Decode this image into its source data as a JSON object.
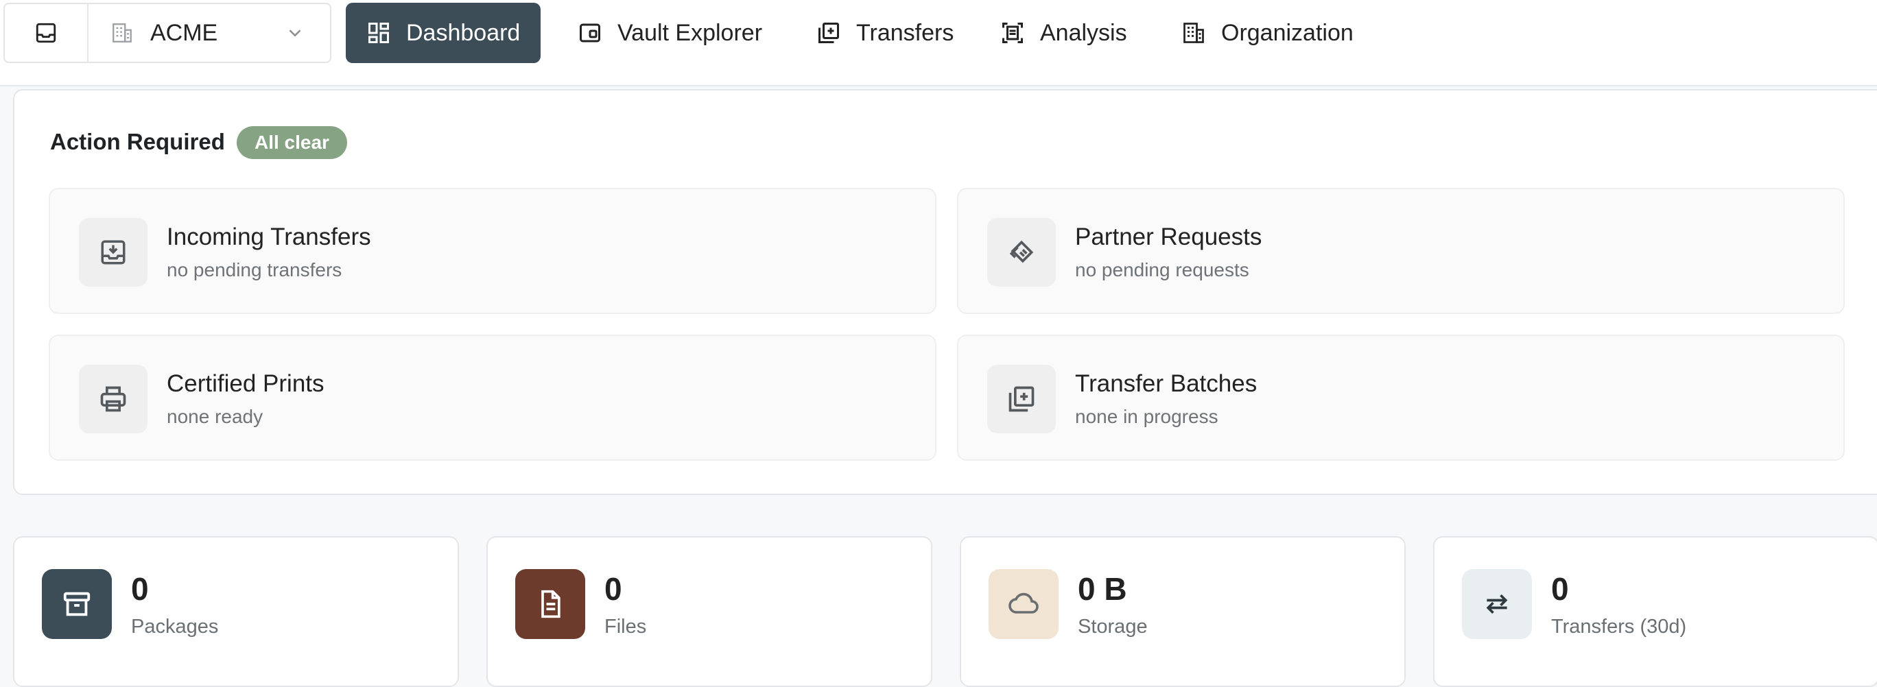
{
  "org_switcher": {
    "name": "ACME"
  },
  "nav": [
    {
      "label": "Dashboard",
      "icon": "dashboard-icon",
      "active": true
    },
    {
      "label": "Vault Explorer",
      "icon": "wallet-icon"
    },
    {
      "label": "Transfers",
      "icon": "stack-plus-icon"
    },
    {
      "label": "Analysis",
      "icon": "scan-document-icon"
    },
    {
      "label": "Organization",
      "icon": "building-icon"
    }
  ],
  "action_required": {
    "title": "Action Required",
    "badge": "All clear",
    "badge_color": "#86a384",
    "cards": [
      {
        "title": "Incoming Transfers",
        "subtitle": "no pending transfers",
        "icon": "inbox-download-icon"
      },
      {
        "title": "Partner Requests",
        "subtitle": "no pending requests",
        "icon": "handshake-icon"
      },
      {
        "title": "Certified Prints",
        "subtitle": "none ready",
        "icon": "printer-icon"
      },
      {
        "title": "Transfer Batches",
        "subtitle": "none in progress",
        "icon": "stack-plus-icon"
      }
    ]
  },
  "stats": [
    {
      "value": "0",
      "label": "Packages",
      "icon": "archive-icon",
      "icon_bg": "#3c4d57"
    },
    {
      "value": "0",
      "label": "Files",
      "icon": "file-icon",
      "icon_bg": "#6d3b2b"
    },
    {
      "value": "0 B",
      "label": "Storage",
      "icon": "cloud-icon",
      "icon_bg": "#f1e4d3"
    },
    {
      "value": "0",
      "label": "Transfers (30d)",
      "icon": "swap-arrows-icon",
      "icon_bg": "#e9eef0"
    }
  ]
}
